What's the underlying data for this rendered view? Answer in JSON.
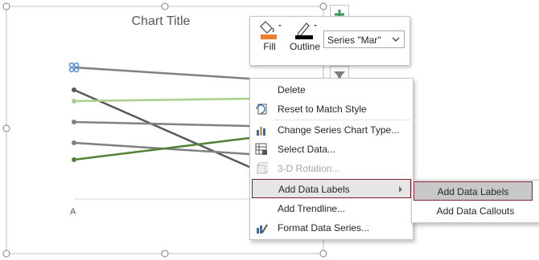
{
  "chart": {
    "title": "Chart Title",
    "category_label": "A",
    "series_colors": {
      "gray": "#808080",
      "dark": "#595959",
      "light_green": "#a9d18e",
      "green": "#548235",
      "selected": "#4a90d9"
    }
  },
  "format_toolbar": {
    "fill_label": "Fill",
    "outline_label": "Outline",
    "series_selected": "Series \"Mar\"",
    "fill_color": "#ed7d31",
    "outline_color": "#000000"
  },
  "context_menu": {
    "items": [
      {
        "label": "Delete",
        "icon": "none"
      },
      {
        "label": "Reset to Match Style",
        "icon": "reset-style-icon"
      },
      {
        "label": "Change Series Chart Type...",
        "icon": "chart-type-icon"
      },
      {
        "label": "Select Data...",
        "icon": "select-data-icon"
      },
      {
        "label": "3-D Rotation...",
        "icon": "3d-rotation-icon"
      },
      {
        "label": "Add Data Labels",
        "icon": "none"
      },
      {
        "label": "Add Trendline...",
        "icon": "none"
      },
      {
        "label": "Format Data Series...",
        "icon": "format-series-icon"
      }
    ]
  },
  "submenu": {
    "items": [
      {
        "label": "Add Data Labels"
      },
      {
        "label": "Add Data Callouts"
      }
    ]
  }
}
